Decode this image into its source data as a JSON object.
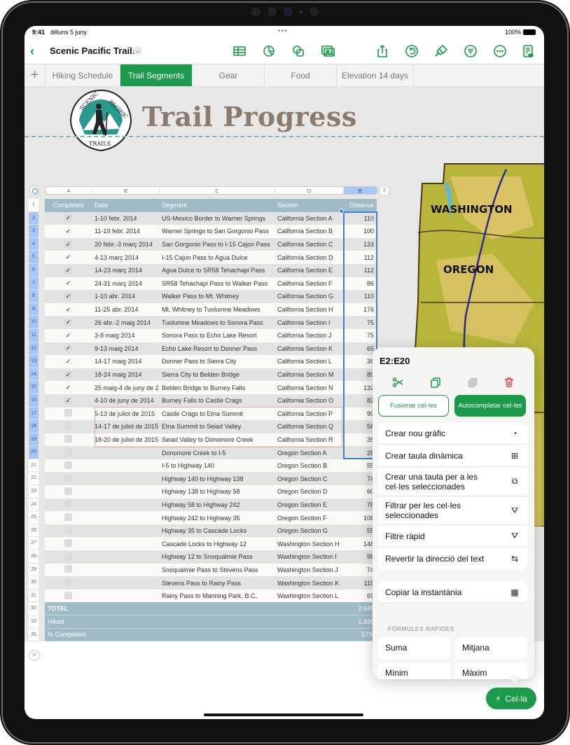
{
  "status_bar": {
    "time": "9:41",
    "date": "dilluns 5 juny",
    "battery": "100%"
  },
  "toolbar": {
    "back_icon": "chevron-left-icon",
    "doc_title": "Scenic Pacific Trails",
    "title_menu_icon": "chevron-down-icon",
    "icons": [
      "table-icon",
      "chart-icon",
      "shape-icon",
      "media-icon",
      "share-icon",
      "undo-icon",
      "format-brush-icon",
      "organize-icon",
      "more-icon",
      "reading-view-icon"
    ]
  },
  "tabs": {
    "add_label": "+",
    "items": [
      {
        "label": "Hiking Schedule",
        "active": false
      },
      {
        "label": "Trail Segments",
        "active": true
      },
      {
        "label": "Gear",
        "active": false
      },
      {
        "label": "Food",
        "active": false
      },
      {
        "label": "Elevation 14 days",
        "active": false
      }
    ]
  },
  "canvas": {
    "logo_text": {
      "top_left": "SCENIC",
      "top_right": "PACIFIC",
      "bottom": "TRAILS"
    },
    "title": "Trail Progress",
    "map_labels": {
      "washington": "WASHINGTON",
      "oregon": "OREGON"
    }
  },
  "sheet": {
    "column_letters": [
      "A",
      "B",
      "C",
      "D",
      "E"
    ],
    "selected_column": "E",
    "headers": [
      "Completed",
      "Date",
      "Segment",
      "Section",
      "Distance"
    ],
    "row_numbers": [
      "1",
      "2",
      "3",
      "4",
      "5",
      "6",
      "7",
      "8",
      "9",
      "10",
      "11",
      "12",
      "13",
      "14",
      "15",
      "16",
      "17",
      "18",
      "19",
      "20",
      "21",
      "22",
      "23",
      "24",
      "25",
      "26",
      "27",
      "28",
      "29",
      "30",
      "31",
      "32",
      "33",
      "35"
    ],
    "rows": [
      {
        "completed": true,
        "date": "1-10 febr. 2014",
        "segment": "US-Mexico Border to Warner Springs",
        "section": "California Section A",
        "distance": "110"
      },
      {
        "completed": true,
        "date": "11-19 febr. 2014",
        "segment": "Warner Springs to San Gorgonio Pass",
        "section": "California Section B",
        "distance": "100"
      },
      {
        "completed": true,
        "date": "20 febr.-3 març 2014",
        "segment": "San Gorgonio Pass to I-15 Cajon Pass",
        "section": "California Section C",
        "distance": "133"
      },
      {
        "completed": true,
        "date": "4-13 març 2014",
        "segment": "I-15 Cajon Pass to Agua Dulce",
        "section": "California Section D",
        "distance": "112"
      },
      {
        "completed": true,
        "date": "14-23 març 2014",
        "segment": "Agua Dulce to SR58 Tehachapi Pass",
        "section": "California Section E",
        "distance": "112"
      },
      {
        "completed": true,
        "date": "24-31 març 2014",
        "segment": "SR58 Tehachapi Pass to Walker Pass",
        "section": "California Section F",
        "distance": "86"
      },
      {
        "completed": true,
        "date": "1-10 abr. 2014",
        "segment": "Walker Pass to Mt. Whitney",
        "section": "California Section G",
        "distance": "110"
      },
      {
        "completed": true,
        "date": "11-25 abr. 2014",
        "segment": "Mt. Whitney to Tuolumne Meadows",
        "section": "California Section H",
        "distance": "176"
      },
      {
        "completed": true,
        "date": "26 abr.-2 maig 2014",
        "segment": "Tuolumne Meadows to Sonora Pass",
        "section": "California Section I",
        "distance": "75"
      },
      {
        "completed": true,
        "date": "3-8 maig 2014",
        "segment": "Sonora Pass to Echo Lake Resort",
        "section": "California Section J",
        "distance": "75"
      },
      {
        "completed": true,
        "date": "9-13 maig 2014",
        "segment": "Echo Lake Resort to Donner Pass",
        "section": "California Section K",
        "distance": "65"
      },
      {
        "completed": true,
        "date": "14-17 maig 2014",
        "segment": "Donner Pass to Sierra City",
        "section": "California Section L",
        "distance": "38"
      },
      {
        "completed": true,
        "date": "18-24 maig 2014",
        "segment": "Sierra City to Belden Bridge",
        "section": "California Section M",
        "distance": "89"
      },
      {
        "completed": true,
        "date": "25 maig-4 de juny de 2",
        "segment": "Belden Bridge to Burney Falls",
        "section": "California Section N",
        "distance": "132"
      },
      {
        "completed": true,
        "date": "4-10 de juny de 2014",
        "segment": "Burney Falls to Castle Crags",
        "section": "California Section O",
        "distance": "82"
      },
      {
        "completed": false,
        "date": "5-13 de juliol de 2015",
        "segment": "Castle Crags to Etna Summit",
        "section": "California Section P",
        "distance": "99"
      },
      {
        "completed": false,
        "date": "14-17 de juliol de 2015",
        "segment": "Etna Summit to Seiad Valley",
        "section": "California Section Q",
        "distance": "56"
      },
      {
        "completed": false,
        "date": "18-20 de juliol de 2015",
        "segment": "Seiad Valley to Donomore Creek",
        "section": "California Section R",
        "distance": "35"
      },
      {
        "completed": false,
        "date": "",
        "segment": "Donomore Creek to I-5",
        "section": "Oregon Section A",
        "distance": "28"
      },
      {
        "completed": false,
        "date": "",
        "segment": "I-5 to Highway 140",
        "section": "Oregon Section B",
        "distance": "55"
      },
      {
        "completed": false,
        "date": "",
        "segment": "Highway 140 to Highway 138",
        "section": "Oregon Section C",
        "distance": "74"
      },
      {
        "completed": false,
        "date": "",
        "segment": "Highway 138 to Highway 58",
        "section": "Oregon Section D",
        "distance": "60"
      },
      {
        "completed": false,
        "date": "",
        "segment": "Highway 58 to Highway 242",
        "section": "Oregon Section E",
        "distance": "76"
      },
      {
        "completed": false,
        "date": "",
        "segment": "Highway 242 to Highway 35",
        "section": "Oregon Section F",
        "distance": "108"
      },
      {
        "completed": false,
        "date": "",
        "segment": "Highway 35 to Cascade Locks",
        "section": "Oregon Section G",
        "distance": "55"
      },
      {
        "completed": false,
        "date": "",
        "segment": "Cascade Locks to Highway 12",
        "section": "Washington Section H",
        "distance": "148"
      },
      {
        "completed": false,
        "date": "",
        "segment": "Highway 12 to Snoqualmie Pass",
        "section": "Washington Section I",
        "distance": "98"
      },
      {
        "completed": false,
        "date": "",
        "segment": "Snoqualmie Pass to Stevens Pass",
        "section": "Washington Section J",
        "distance": "74"
      },
      {
        "completed": false,
        "date": "",
        "segment": "Stevens Pass to Rainy Pass",
        "section": "Washington Section K",
        "distance": "115"
      },
      {
        "completed": false,
        "date": "",
        "segment": "Rainy Pass to Manning Park, B.C.",
        "section": "Washington Section L",
        "distance": "69"
      }
    ],
    "footer": [
      {
        "label": "TOTAL",
        "value": "2.645"
      },
      {
        "label": "Hiked",
        "value": "1.495"
      },
      {
        "label": "% Completed",
        "value": "57%"
      }
    ]
  },
  "popover": {
    "range": "E2:E20",
    "icons": [
      "scissors-icon",
      "copy-icon",
      "paste-icon",
      "trash-icon"
    ],
    "merge_label": "Fusionar cel·les",
    "autofill_label": "Autocompletar cel·les",
    "menu": [
      {
        "label": "Crear nou gràfic",
        "icon": "◔"
      },
      {
        "label": "Crear taula dinàmica",
        "icon": "⊞"
      },
      {
        "label": "Crear una taula per a les cel·les seleccionades",
        "icon": "⧉"
      },
      {
        "label": "Filtrar per les cel·les seleccionades",
        "icon": "⛛"
      },
      {
        "label": "Filtre ràpid",
        "icon": "⛛"
      },
      {
        "label": "Revertir la direcció del text",
        "icon": "⇆"
      }
    ],
    "snapshot_label": "Copiar la instantània",
    "snapshot_icon": "▦",
    "quick_formulas_label": "FÓRMULES RÀPIDES",
    "quick_formulas": [
      "Suma",
      "Mitjana",
      "Mínim",
      "Màxim"
    ]
  },
  "cell_button": {
    "label": "Cel·la",
    "icon": "bolt-icon"
  },
  "colors": {
    "accent": "#1a9a4a",
    "header": "#9fbbc6",
    "selection": "#3b7fd8",
    "title": "#8b7a6e",
    "delete": "#e5484d"
  }
}
